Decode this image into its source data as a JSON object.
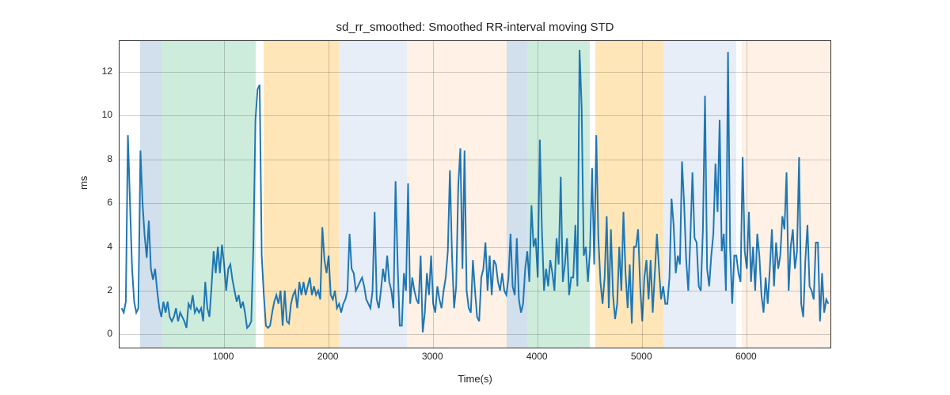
{
  "chart_data": {
    "type": "line",
    "title": "sd_rr_smoothed: Smoothed RR-interval moving STD",
    "xlabel": "Time(s)",
    "ylabel": "ms",
    "xlim": [
      0,
      6800
    ],
    "ylim": [
      -0.6,
      13.4
    ],
    "xticks": [
      1000,
      2000,
      3000,
      4000,
      5000,
      6000
    ],
    "yticks": [
      0,
      2,
      4,
      6,
      8,
      10,
      12
    ],
    "regions": [
      {
        "x0": 200,
        "x1": 400,
        "color": "blue"
      },
      {
        "x0": 400,
        "x1": 1300,
        "color": "green"
      },
      {
        "x0": 1380,
        "x1": 2100,
        "color": "orange"
      },
      {
        "x0": 2100,
        "x1": 2750,
        "color": "lblue"
      },
      {
        "x0": 2750,
        "x1": 3700,
        "color": "peach"
      },
      {
        "x0": 3700,
        "x1": 3900,
        "color": "blue"
      },
      {
        "x0": 3900,
        "x1": 4500,
        "color": "green"
      },
      {
        "x0": 4550,
        "x1": 5200,
        "color": "orange"
      },
      {
        "x0": 5200,
        "x1": 5900,
        "color": "lblue"
      },
      {
        "x0": 5950,
        "x1": 6800,
        "color": "peach"
      }
    ],
    "series": [
      {
        "name": "sd_rr_smoothed",
        "x": [
          20,
          40,
          60,
          80,
          100,
          120,
          140,
          160,
          180,
          200,
          220,
          240,
          260,
          280,
          300,
          320,
          340,
          360,
          380,
          400,
          420,
          440,
          460,
          480,
          500,
          520,
          540,
          560,
          580,
          600,
          620,
          640,
          660,
          680,
          700,
          720,
          740,
          760,
          780,
          800,
          820,
          840,
          860,
          880,
          900,
          920,
          940,
          960,
          980,
          1000,
          1020,
          1040,
          1060,
          1080,
          1100,
          1120,
          1140,
          1160,
          1180,
          1200,
          1220,
          1240,
          1260,
          1280,
          1300,
          1320,
          1340,
          1360,
          1380,
          1400,
          1420,
          1440,
          1460,
          1480,
          1500,
          1520,
          1540,
          1560,
          1580,
          1600,
          1620,
          1640,
          1660,
          1680,
          1700,
          1720,
          1740,
          1760,
          1780,
          1800,
          1820,
          1840,
          1860,
          1880,
          1900,
          1920,
          1940,
          1960,
          1980,
          2000,
          2020,
          2040,
          2060,
          2080,
          2100,
          2120,
          2140,
          2160,
          2180,
          2200,
          2220,
          2240,
          2260,
          2280,
          2300,
          2320,
          2340,
          2360,
          2380,
          2400,
          2420,
          2440,
          2460,
          2480,
          2500,
          2520,
          2540,
          2560,
          2580,
          2600,
          2620,
          2640,
          2660,
          2680,
          2700,
          2720,
          2740,
          2760,
          2780,
          2800,
          2820,
          2840,
          2860,
          2880,
          2900,
          2920,
          2940,
          2960,
          2980,
          3000,
          3020,
          3040,
          3060,
          3080,
          3100,
          3120,
          3140,
          3160,
          3180,
          3200,
          3220,
          3240,
          3260,
          3280,
          3300,
          3320,
          3340,
          3360,
          3380,
          3400,
          3420,
          3440,
          3460,
          3480,
          3500,
          3520,
          3540,
          3560,
          3580,
          3600,
          3620,
          3640,
          3660,
          3680,
          3700,
          3720,
          3740,
          3760,
          3780,
          3800,
          3820,
          3840,
          3860,
          3880,
          3900,
          3920,
          3940,
          3960,
          3980,
          4000,
          4020,
          4040,
          4060,
          4080,
          4100,
          4120,
          4140,
          4160,
          4180,
          4200,
          4220,
          4240,
          4260,
          4280,
          4300,
          4320,
          4340,
          4360,
          4380,
          4400,
          4420,
          4440,
          4460,
          4480,
          4500,
          4520,
          4540,
          4560,
          4580,
          4600,
          4620,
          4640,
          4660,
          4680,
          4700,
          4720,
          4740,
          4760,
          4780,
          4800,
          4820,
          4840,
          4860,
          4880,
          4900,
          4920,
          4940,
          4960,
          4980,
          5000,
          5020,
          5040,
          5060,
          5080,
          5100,
          5120,
          5140,
          5160,
          5180,
          5200,
          5220,
          5240,
          5260,
          5280,
          5300,
          5320,
          5340,
          5360,
          5380,
          5400,
          5420,
          5440,
          5460,
          5480,
          5500,
          5520,
          5540,
          5560,
          5580,
          5600,
          5620,
          5640,
          5660,
          5680,
          5700,
          5720,
          5740,
          5760,
          5780,
          5800,
          5820,
          5840,
          5860,
          5880,
          5900,
          5920,
          5940,
          5960,
          5980,
          6000,
          6020,
          6040,
          6060,
          6080,
          6100,
          6120,
          6140,
          6160,
          6180,
          6200,
          6220,
          6240,
          6260,
          6280,
          6300,
          6320,
          6340,
          6360,
          6380,
          6400,
          6420,
          6440,
          6460,
          6480,
          6500,
          6520,
          6540,
          6560,
          6580,
          6600,
          6620,
          6640,
          6660,
          6680,
          6700,
          6720,
          6740,
          6760,
          6780
        ],
        "y": [
          1.2,
          1.0,
          1.5,
          9.1,
          6.0,
          3.0,
          1.5,
          1.0,
          1.2,
          8.4,
          6.0,
          4.5,
          3.5,
          5.2,
          3.0,
          2.5,
          3.0,
          2.0,
          1.2,
          0.8,
          1.5,
          1.0,
          1.5,
          0.8,
          0.6,
          0.8,
          1.2,
          0.6,
          1.0,
          0.8,
          0.6,
          0.3,
          1.4,
          1.2,
          1.8,
          1.0,
          1.2,
          1.0,
          1.2,
          0.6,
          2.4,
          1.2,
          0.8,
          2.2,
          3.8,
          2.8,
          4.0,
          2.8,
          4.1,
          3.2,
          2.0,
          3.0,
          3.2,
          2.5,
          2.0,
          1.5,
          1.8,
          1.2,
          1.5,
          1.0,
          0.3,
          0.4,
          0.6,
          4.0,
          9.8,
          11.2,
          11.4,
          3.6,
          1.8,
          0.4,
          0.3,
          0.4,
          1.0,
          1.5,
          1.8,
          1.4,
          2.0,
          0.4,
          2.0,
          0.6,
          0.5,
          1.4,
          1.8,
          2.0,
          1.2,
          2.4,
          1.8,
          2.4,
          1.8,
          2.2,
          2.6,
          1.8,
          2.2,
          1.8,
          2.0,
          1.6,
          4.9,
          3.4,
          2.8,
          3.6,
          1.8,
          1.6,
          2.0,
          1.2,
          1.4,
          1.0,
          1.4,
          1.6,
          2.0,
          4.6,
          3.0,
          2.8,
          2.0,
          2.2,
          2.4,
          2.6,
          2.2,
          1.6,
          1.4,
          1.2,
          2.0,
          5.6,
          1.6,
          1.2,
          2.0,
          3.0,
          2.4,
          3.6,
          2.4,
          2.0,
          1.2,
          7.0,
          3.2,
          0.4,
          0.4,
          2.8,
          2.0,
          6.9,
          1.4,
          2.6,
          2.0,
          1.6,
          1.4,
          3.6,
          0.1,
          1.0,
          2.8,
          1.8,
          3.6,
          1.4,
          1.0,
          2.2,
          1.6,
          1.2,
          2.0,
          2.6,
          3.8,
          7.5,
          3.6,
          1.2,
          2.2,
          6.8,
          8.5,
          3.0,
          8.4,
          2.0,
          1.2,
          1.0,
          3.4,
          2.0,
          0.8,
          0.6,
          2.6,
          3.0,
          4.2,
          2.0,
          3.6,
          1.8,
          3.4,
          3.2,
          2.4,
          2.0,
          2.8,
          2.0,
          1.8,
          2.6,
          4.6,
          2.2,
          1.8,
          4.4,
          1.6,
          1.0,
          1.4,
          3.0,
          3.8,
          2.4,
          5.9,
          4.0,
          4.4,
          2.6,
          8.9,
          4.8,
          2.0,
          3.0,
          2.2,
          3.4,
          2.8,
          2.0,
          4.4,
          3.2,
          7.2,
          2.4,
          3.2,
          4.4,
          1.8,
          2.6,
          2.6,
          5.0,
          2.2,
          13.0,
          10.4,
          3.6,
          4.0,
          2.4,
          3.8,
          7.6,
          3.2,
          9.1,
          4.4,
          2.4,
          1.4,
          2.6,
          5.4,
          1.2,
          4.8,
          1.8,
          0.7,
          1.4,
          4.0,
          2.0,
          5.6,
          2.8,
          1.2,
          3.2,
          0.5,
          4.0,
          4.0,
          4.8,
          2.2,
          0.6,
          2.6,
          3.4,
          1.6,
          3.4,
          1.0,
          2.8,
          4.6,
          3.0,
          1.6,
          2.2,
          1.4,
          1.4,
          2.6,
          6.2,
          5.0,
          2.8,
          3.6,
          3.2,
          7.9,
          6.0,
          3.4,
          2.0,
          4.4,
          7.4,
          4.4,
          4.2,
          2.2,
          2.0,
          4.8,
          10.9,
          3.0,
          2.2,
          3.6,
          4.6,
          7.8,
          5.6,
          9.8,
          3.8,
          4.6,
          2.0,
          12.9,
          4.0,
          1.4,
          3.6,
          3.6,
          2.8,
          2.4,
          8.1,
          3.8,
          3.0,
          5.6,
          2.4,
          4.0,
          2.0,
          4.6,
          3.6,
          1.8,
          1.0,
          2.6,
          1.4,
          3.0,
          4.8,
          2.2,
          4.2,
          3.0,
          3.6,
          5.4,
          4.8,
          7.4,
          2.0,
          4.0,
          4.8,
          3.0,
          3.8,
          8.1,
          1.4,
          0.8,
          3.4,
          5.0,
          2.2,
          2.0,
          1.6,
          4.2,
          4.2,
          0.6,
          2.8,
          1.0,
          1.6,
          1.4
        ]
      }
    ]
  }
}
